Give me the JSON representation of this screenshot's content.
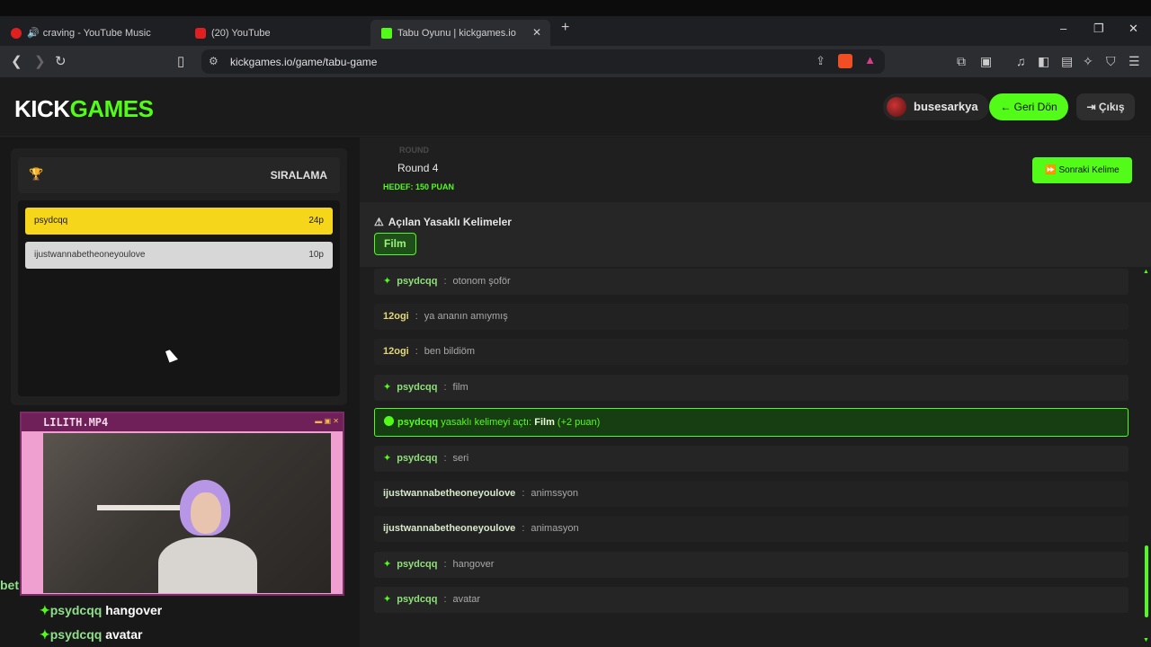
{
  "browser": {
    "tabs": [
      {
        "label": "craving - YouTube Music",
        "icon": "youtube-music-icon",
        "color": "#e02020"
      },
      {
        "label": "(20) YouTube",
        "icon": "youtube-icon",
        "color": "#e02020"
      },
      {
        "label": "Tabu Oyunu | kickgames.io",
        "icon": "kickgames-icon",
        "color": "#53fc18"
      }
    ],
    "url": "kickgames.io/game/tabu-game"
  },
  "header": {
    "logo_a": "KICK",
    "logo_b": "GAMES",
    "username": "busesarkya",
    "back_label": "Geri Dön",
    "exit_label": "Çıkış"
  },
  "ranking": {
    "title": "SIRALAMA",
    "players": [
      {
        "name": "psydcqq",
        "points": "24p"
      },
      {
        "name": "ijustwannabetheoneyoulove",
        "points": "10p"
      }
    ]
  },
  "stream_overlay": {
    "title": "LILITH.MP4"
  },
  "left_chat": {
    "fragment": "bet",
    "lines": [
      {
        "user": "psydcqq",
        "text": "hangover"
      },
      {
        "user": "psydcqq",
        "text": "avatar"
      }
    ]
  },
  "game": {
    "round_ghost": "ROUND",
    "round": "Round 4",
    "target": "HEDEF: 150 PUAN",
    "next_label": "Sonraki Kelime",
    "banned_title": "Açılan Yasaklı Kelimeler",
    "banned_words": [
      "Film"
    ]
  },
  "messages": [
    {
      "user": "psydcqq",
      "text": "otonom şoför",
      "star": true,
      "color": "g"
    },
    {
      "user": "12ogi",
      "text": "ya ananın amıymış",
      "star": false,
      "color": "y"
    },
    {
      "user": "12ogi",
      "text": "ben bildiöm",
      "star": false,
      "color": "y"
    },
    {
      "user": "psydcqq",
      "text": "film",
      "star": true,
      "color": "g"
    },
    {
      "event": true,
      "user": "psydcqq",
      "action": "yasaklı kelimeyi açtı:",
      "word": "Film",
      "bonus": "(+2 puan)"
    },
    {
      "user": "psydcqq",
      "text": "seri",
      "star": true,
      "color": "g"
    },
    {
      "user": "ijustwannabetheoneyoulove",
      "text": "animssyon",
      "star": false,
      "color": "w"
    },
    {
      "user": "ijustwannabetheoneyoulove",
      "text": "animasyon",
      "star": false,
      "color": "w"
    },
    {
      "user": "psydcqq",
      "text": "hangover",
      "star": true,
      "color": "g"
    },
    {
      "user": "psydcqq",
      "text": "avatar",
      "star": true,
      "color": "g"
    }
  ],
  "colors": {
    "accent": "#53fc18",
    "gold": "#f6d61a",
    "silver": "#d7d7d7"
  }
}
